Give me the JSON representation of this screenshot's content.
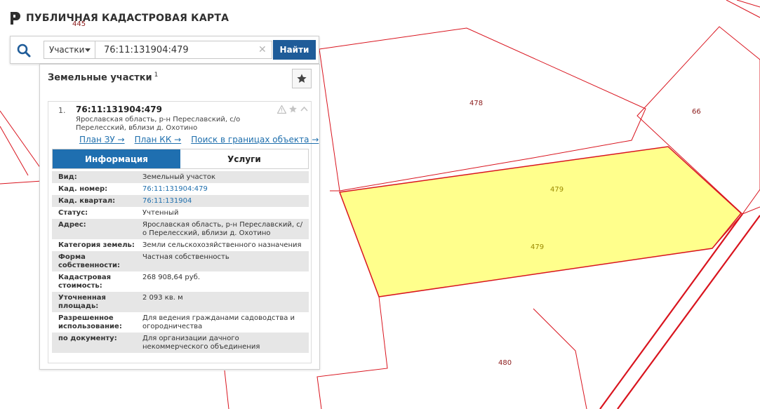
{
  "app": {
    "title": "ПУБЛИЧНАЯ КАДАСТРОВАЯ КАРТА"
  },
  "search": {
    "type_selected": "Участки",
    "query": "76:11:131904:479",
    "find_label": "Найти",
    "clear_glyph": "✕"
  },
  "panel": {
    "title": "Земельные участки",
    "count": "1"
  },
  "result": {
    "number": "1.",
    "cad_id": "76:11:131904:479",
    "address": "Ярославская область, р-н Переславский, с/о Перелесский, вблизи д. Охотино",
    "links": [
      "План ЗУ →",
      "План КК →",
      "Поиск в границах объекта →"
    ],
    "tabs": [
      {
        "label": "Информация",
        "active": true
      },
      {
        "label": "Услуги",
        "active": false
      }
    ],
    "properties": [
      {
        "key": "Вид:",
        "value": "Земельный участок",
        "link": false
      },
      {
        "key": "Кад. номер:",
        "value": "76:11:131904:479",
        "link": true
      },
      {
        "key": "Кад. квартал:",
        "value": "76:11:131904",
        "link": true
      },
      {
        "key": "Статус:",
        "value": "Учтенный",
        "link": false
      },
      {
        "key": "Адрес:",
        "value": "Ярославская область, р-н Переславский, с/о Перелесский, вблизи д. Охотино",
        "link": false
      },
      {
        "key": "Категория земель:",
        "value": "Земли сельскохозяйственного назначения",
        "link": false
      },
      {
        "key": "Форма собственности:",
        "value": "Частная собственность",
        "link": false
      },
      {
        "key": "Кадастровая стоимость:",
        "value": "268 908,64 руб.",
        "link": false
      },
      {
        "key": "Уточненная площадь:",
        "value": "2 093 кв. м",
        "link": false
      },
      {
        "key": "Разрешенное использование:",
        "value": "Для ведения гражданами садоводства и огородничества",
        "link": false
      },
      {
        "key": "по документу:",
        "value": "Для организации дачного некоммерческого объединения",
        "link": false
      }
    ]
  },
  "map": {
    "labels": [
      {
        "text": "445",
        "selected": false
      },
      {
        "text": "478",
        "selected": false
      },
      {
        "text": "66",
        "selected": false
      },
      {
        "text": "479",
        "selected": true
      },
      {
        "text": "479",
        "selected": true
      },
      {
        "text": "480",
        "selected": false
      }
    ],
    "colors": {
      "boundary": "#d9141e",
      "selected_fill": "#ffff8c",
      "accent": "#1f5c99"
    }
  }
}
